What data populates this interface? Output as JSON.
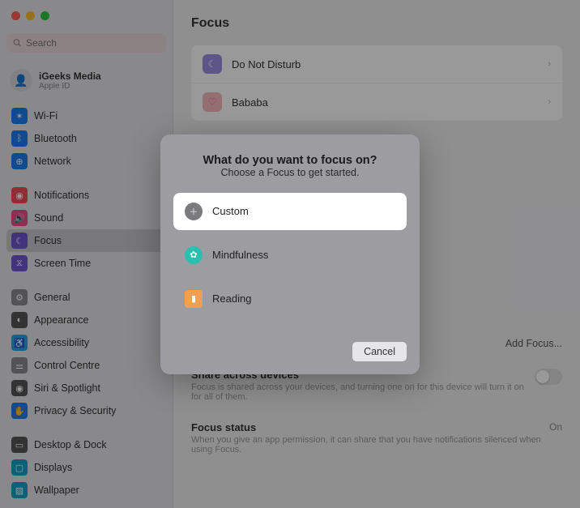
{
  "search": {
    "placeholder": "Search"
  },
  "account": {
    "name": "iGeeks Media",
    "sub": "Apple ID"
  },
  "sidebar": {
    "grp1": [
      {
        "label": "Wi-Fi"
      },
      {
        "label": "Bluetooth"
      },
      {
        "label": "Network"
      }
    ],
    "grp2": [
      {
        "label": "Notifications"
      },
      {
        "label": "Sound"
      },
      {
        "label": "Focus"
      },
      {
        "label": "Screen Time"
      }
    ],
    "grp3": [
      {
        "label": "General"
      },
      {
        "label": "Appearance"
      },
      {
        "label": "Accessibility"
      },
      {
        "label": "Control Centre"
      },
      {
        "label": "Siri & Spotlight"
      },
      {
        "label": "Privacy & Security"
      }
    ],
    "grp4": [
      {
        "label": "Desktop & Dock"
      },
      {
        "label": "Displays"
      },
      {
        "label": "Wallpaper"
      }
    ]
  },
  "main": {
    "title": "Focus",
    "rows": [
      {
        "label": "Do Not Disturb"
      },
      {
        "label": "Bababa"
      }
    ],
    "add": "Add Focus...",
    "share_title": "Share across devices",
    "share_desc": "Focus is shared across your devices, and turning one on for this device will turn it on for all of them.",
    "status_title": "Focus status",
    "status_val": "On",
    "status_desc": "When you give an app permission, it can share that you have notifications silenced when using Focus."
  },
  "modal": {
    "title": "What do you want to focus on?",
    "sub": "Choose a Focus to get started.",
    "opts": [
      {
        "label": "Custom"
      },
      {
        "label": "Mindfulness"
      },
      {
        "label": "Reading"
      }
    ],
    "cancel": "Cancel"
  }
}
